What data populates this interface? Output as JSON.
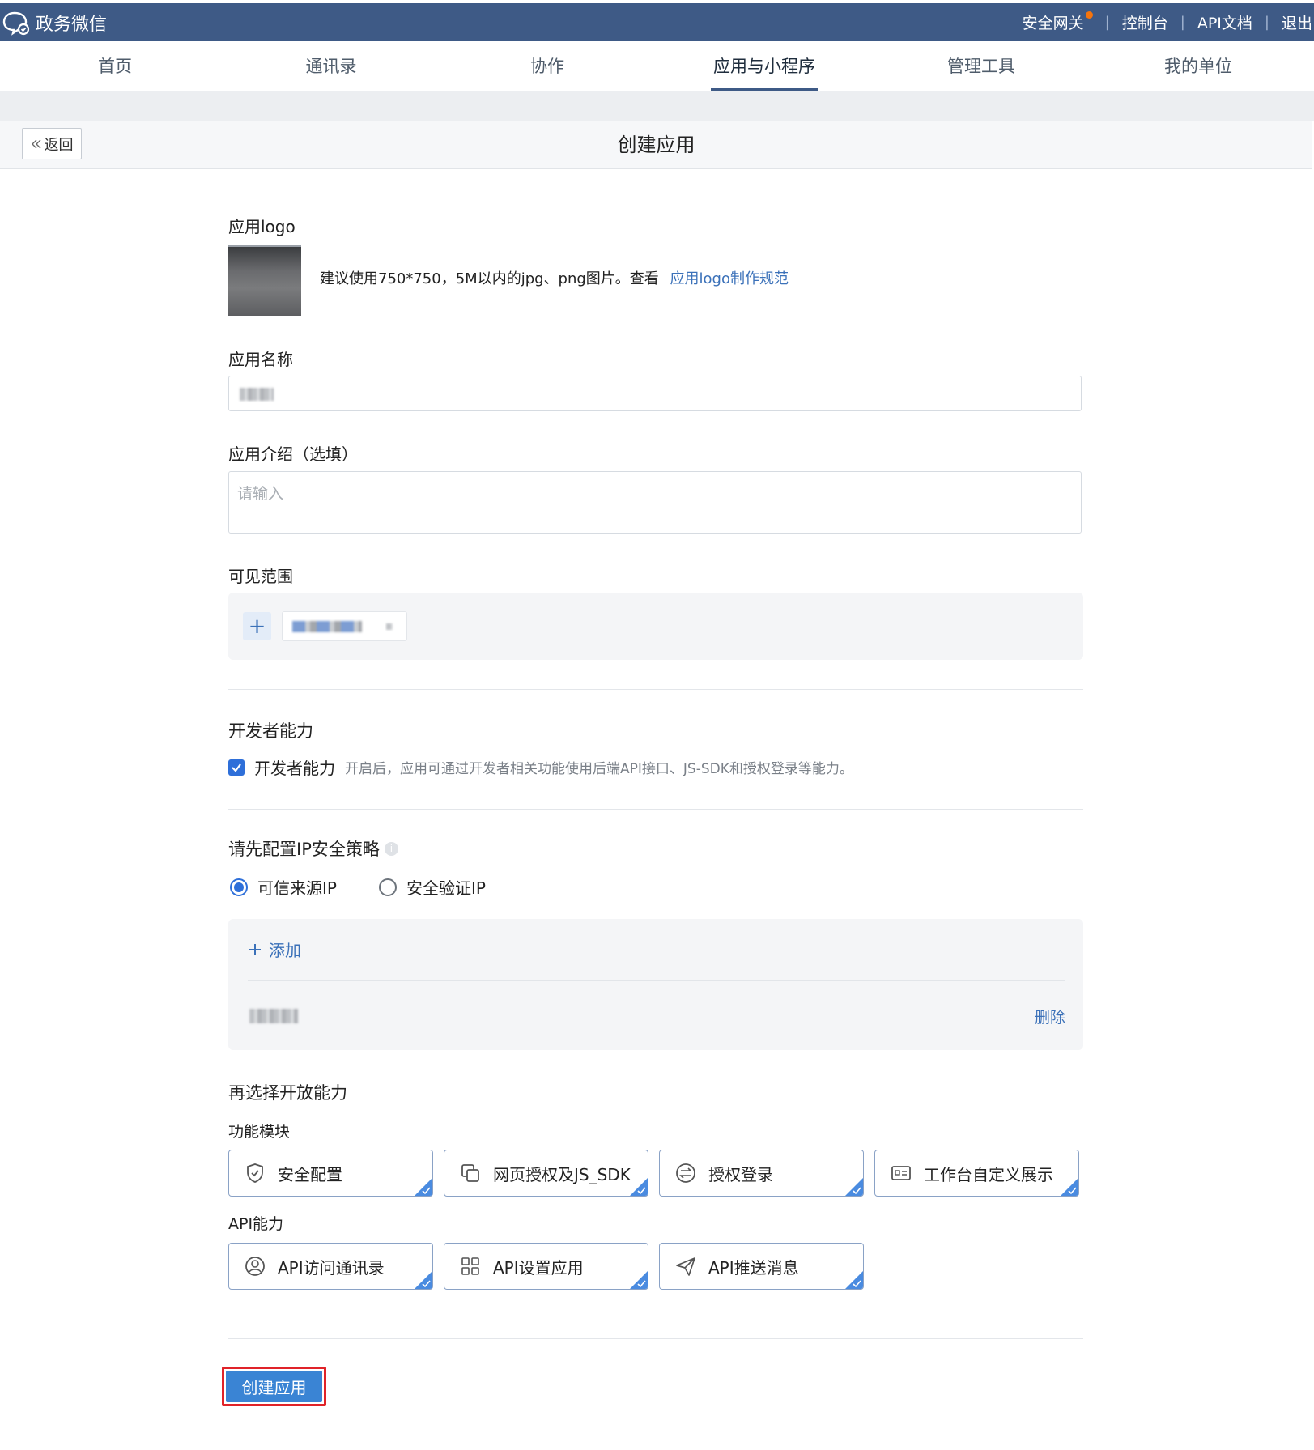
{
  "topbar": {
    "brand": "政务微信",
    "links": [
      "安全网关",
      "控制台",
      "API文档",
      "退出"
    ]
  },
  "nav": {
    "items": [
      "首页",
      "通讯录",
      "协作",
      "应用与小程序",
      "管理工具",
      "我的单位"
    ],
    "active_index": 3
  },
  "header": {
    "back_label": "返回",
    "title": "创建应用"
  },
  "form": {
    "logo_label": "应用logo",
    "logo_hint": "建议使用750*750，5M以内的jpg、png图片。查看",
    "logo_link": "应用logo制作规范",
    "name_label": "应用名称",
    "intro_label": "应用介绍（选填）",
    "intro_placeholder": "请输入",
    "scope_label": "可见范围",
    "scope_add": "+",
    "dev_section": "开发者能力",
    "dev_checkbox_label": "开发者能力",
    "dev_checkbox_checked": true,
    "dev_desc": "开启后，应用可通过开发者相关功能使用后端API接口、JS-SDK和授权登录等能力。",
    "ip_section": "请先配置IP安全策略",
    "ip_options": [
      "可信来源IP",
      "安全验证IP"
    ],
    "ip_selected": 0,
    "ip_add": "添加",
    "ip_delete": "删除",
    "open_section": "再选择开放能力",
    "func_label": "功能模块",
    "func_modules": [
      {
        "label": "安全配置",
        "icon": "shield-icon"
      },
      {
        "label": "网页授权及JS_SDK",
        "icon": "link-window-icon"
      },
      {
        "label": "授权登录",
        "icon": "exchange-icon"
      },
      {
        "label": "工作台自定义展示",
        "icon": "card-display-icon"
      }
    ],
    "api_label": "API能力",
    "api_modules": [
      {
        "label": "API访问通讯录",
        "icon": "user-circle-icon"
      },
      {
        "label": "API设置应用",
        "icon": "grid-icon"
      },
      {
        "label": "API推送消息",
        "icon": "send-icon"
      }
    ],
    "submit_label": "创建应用"
  },
  "colors": {
    "topbar": "#3e5a86",
    "accent": "#2e6fd9",
    "link": "#3b71b9",
    "highlight": "#e02329"
  }
}
